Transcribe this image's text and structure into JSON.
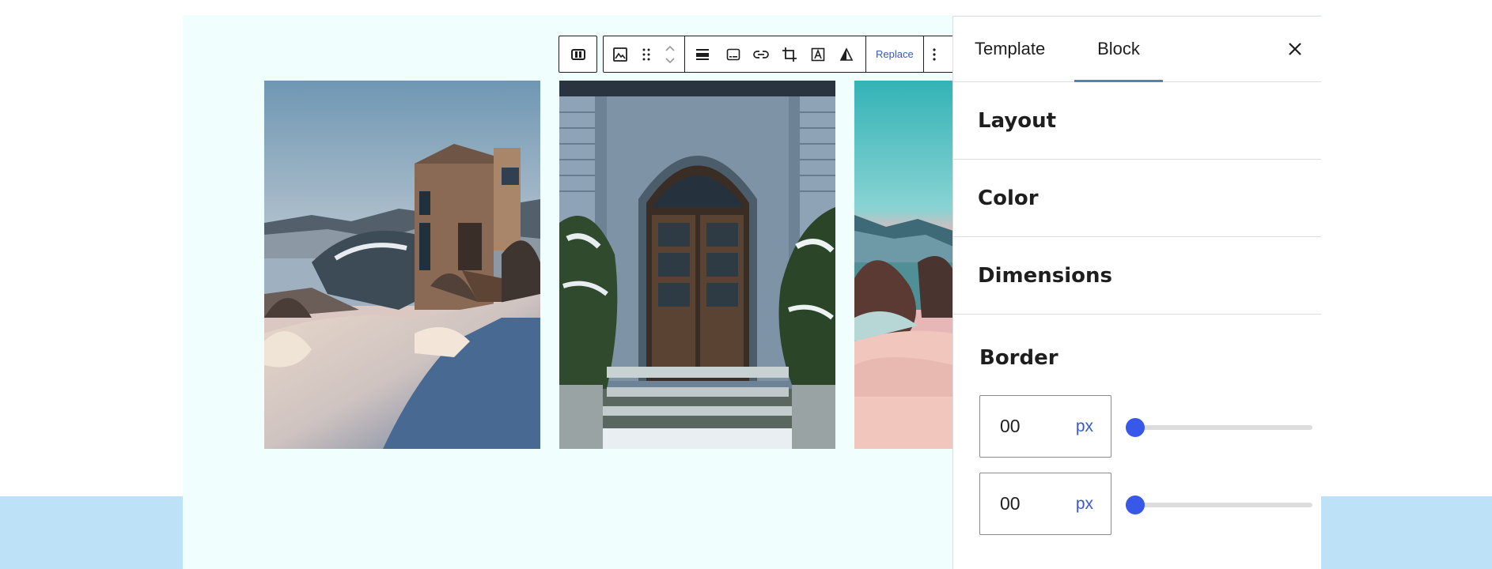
{
  "toolbar": {
    "icons": [
      "gallery-icon",
      "image-icon",
      "drag-handle-icon",
      "move-up-down-icon",
      "align-icon",
      "caption-icon",
      "link-icon",
      "crop-icon",
      "text-overlay-icon",
      "duotone-icon",
      "more-options-icon"
    ],
    "replace_label": "Replace"
  },
  "sidebar": {
    "tabs": [
      {
        "label": "Template",
        "active": false
      },
      {
        "label": "Block",
        "active": true
      }
    ],
    "panels": [
      {
        "title": "Layout"
      },
      {
        "title": "Color"
      },
      {
        "title": "Dimensions"
      }
    ],
    "border": {
      "title": "Border",
      "controls": [
        {
          "value": "00",
          "unit": "px",
          "slider_fraction": 0
        },
        {
          "value": "00",
          "unit": "px",
          "slider_fraction": 0
        }
      ]
    }
  },
  "colors": {
    "accent": "#3858e9",
    "canvas_bg": "#f1fefe",
    "band_bg": "#bde2f8"
  }
}
